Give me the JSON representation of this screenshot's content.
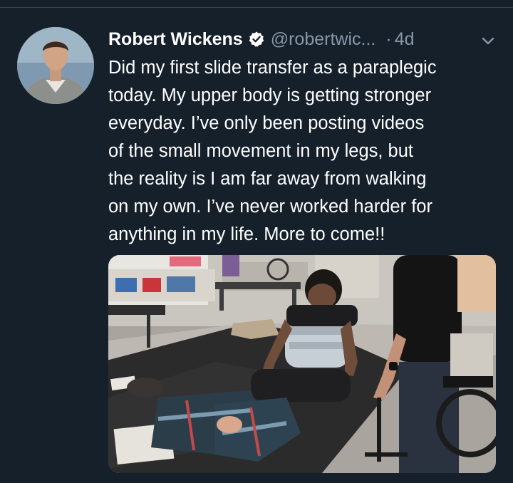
{
  "tweet": {
    "author_name": "Robert Wickens",
    "handle": "@robertwic...",
    "separator": "·",
    "time": "4d",
    "text_lines": [
      "Did my first slide transfer as a paraplegic",
      "today. My upper body is getting stronger",
      "everyday. I’ve only been posting videos",
      "of the small movement in my legs, but",
      "the reality is I am far away from walking",
      "on my own. I’ve never worked harder for",
      "anything in my life. More to come!!"
    ]
  },
  "icons": {
    "verified": "verified-badge-icon",
    "menu": "chevron-down-icon"
  },
  "colors": {
    "background": "#15202b",
    "name_text": "#ffffff",
    "secondary_text": "#8899a6",
    "divider": "#38444d"
  }
}
